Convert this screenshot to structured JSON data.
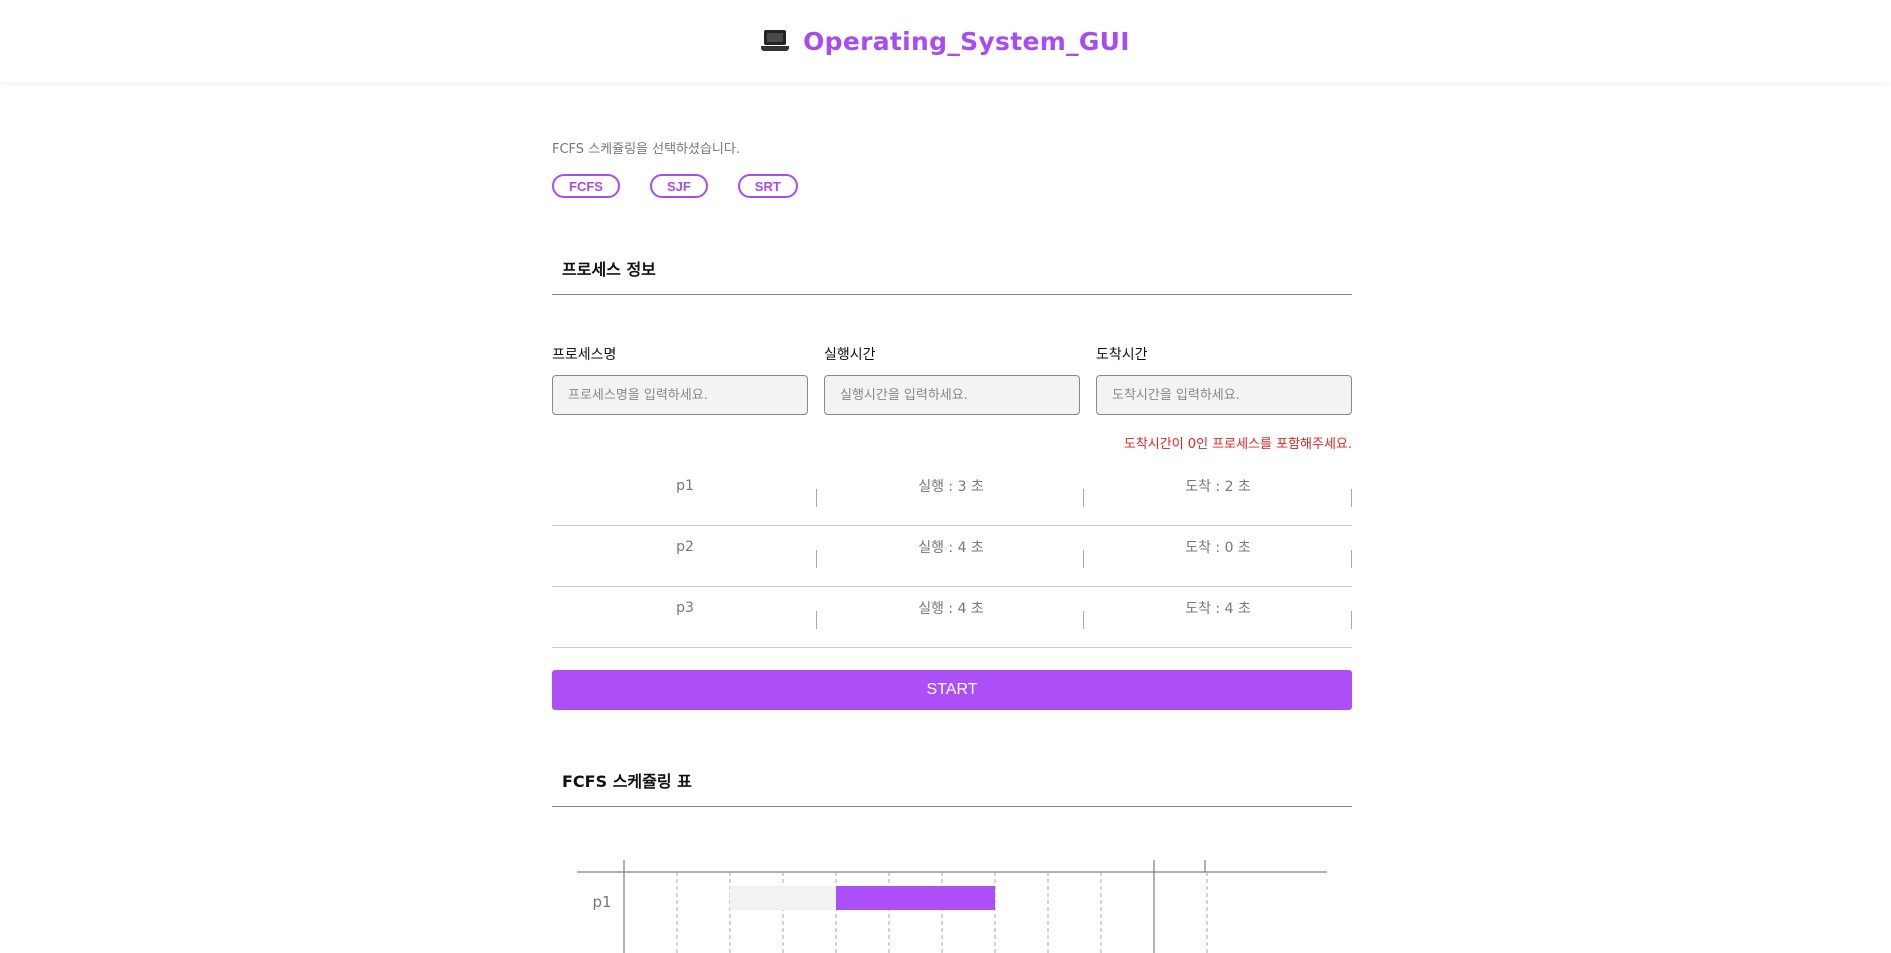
{
  "header": {
    "title": "Operating_System_GUI",
    "icon": "laptop-icon"
  },
  "scheduler": {
    "selected_message": "FCFS 스케쥴링을 선택하셨습니다.",
    "algorithms": [
      "FCFS",
      "SJF",
      "SRT"
    ]
  },
  "process_info": {
    "title": "프로세스 정보",
    "fields": [
      {
        "label": "프로세스명",
        "placeholder": "프로세스명을 입력하세요.",
        "value": ""
      },
      {
        "label": "실행시간",
        "placeholder": "실행시간을 입력하세요.",
        "value": ""
      },
      {
        "label": "도착시간",
        "placeholder": "도착시간을 입력하세요.",
        "value": ""
      }
    ],
    "warning": "도착시간이 0인 프로세스를 포함해주세요.",
    "warning_color": "#e02424",
    "processes": [
      {
        "name": "p1",
        "run": "실행 : 3 초",
        "arrival": "도착 : 2 초"
      },
      {
        "name": "p2",
        "run": "실행 : 4 초",
        "arrival": "도착 : 0 초"
      },
      {
        "name": "p3",
        "run": "실행 : 4 초",
        "arrival": "도착 : 4 초"
      }
    ],
    "start_label": "START"
  },
  "schedule_table": {
    "title": "FCFS 스케쥴링 표",
    "rows": [
      {
        "name": "p1",
        "wait": [
          2,
          4
        ],
        "run": [
          4,
          7
        ]
      }
    ],
    "time_slots": 11
  },
  "colors": {
    "accent": "#a84bf0",
    "button": "#ad4ff6",
    "wait_bar": "#f2f2f2"
  }
}
